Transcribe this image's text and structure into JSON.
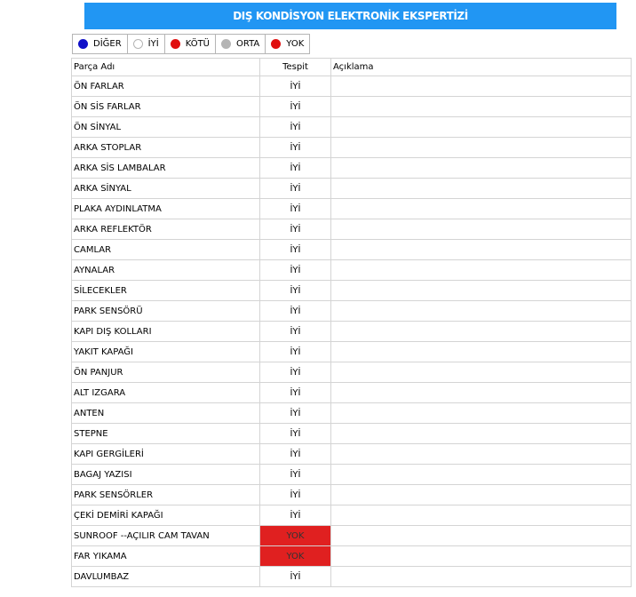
{
  "header": {
    "title": "DIŞ KONDİSYON ELEKTRONİK EKSPERTİZİ"
  },
  "legend": [
    {
      "label": "DİĞER",
      "color": "#1010c8"
    },
    {
      "label": "İYİ",
      "color": "#ffffff"
    },
    {
      "label": "KÖTÜ",
      "color": "#e01010"
    },
    {
      "label": "ORTA",
      "color": "#b4b4b4"
    },
    {
      "label": "YOK",
      "color": "#e01010"
    }
  ],
  "table": {
    "headers": {
      "part": "Parça Adı",
      "status": "Tespit",
      "note": "Açıklama"
    },
    "rows": [
      {
        "part": "ÖN FARLAR",
        "status": "İYİ",
        "note": ""
      },
      {
        "part": "ÖN SİS FARLAR",
        "status": "İYİ",
        "note": ""
      },
      {
        "part": "ÖN SİNYAL",
        "status": "İYİ",
        "note": ""
      },
      {
        "part": "ARKA STOPLAR",
        "status": "İYİ",
        "note": ""
      },
      {
        "part": "ARKA SİS LAMBALAR",
        "status": "İYİ",
        "note": ""
      },
      {
        "part": "ARKA SİNYAL",
        "status": "İYİ",
        "note": ""
      },
      {
        "part": "PLAKA AYDINLATMA",
        "status": "İYİ",
        "note": ""
      },
      {
        "part": "ARKA REFLEKTÖR",
        "status": "İYİ",
        "note": ""
      },
      {
        "part": "CAMLAR",
        "status": "İYİ",
        "note": ""
      },
      {
        "part": "AYNALAR",
        "status": "İYİ",
        "note": ""
      },
      {
        "part": "SİLECEKLER",
        "status": "İYİ",
        "note": ""
      },
      {
        "part": "PARK SENSÖRÜ",
        "status": "İYİ",
        "note": ""
      },
      {
        "part": "KAPI DIŞ KOLLARI",
        "status": "İYİ",
        "note": ""
      },
      {
        "part": "YAKIT KAPAĞI",
        "status": "İYİ",
        "note": ""
      },
      {
        "part": "ÖN PANJUR",
        "status": "İYİ",
        "note": ""
      },
      {
        "part": "ALT IZGARA",
        "status": "İYİ",
        "note": ""
      },
      {
        "part": "ANTEN",
        "status": "İYİ",
        "note": ""
      },
      {
        "part": "STEPNE",
        "status": "İYİ",
        "note": ""
      },
      {
        "part": "KAPI GERGİLERİ",
        "status": "İYİ",
        "note": ""
      },
      {
        "part": "BAGAJ YAZISI",
        "status": "İYİ",
        "note": ""
      },
      {
        "part": "PARK SENSÖRLER",
        "status": "İYİ",
        "note": ""
      },
      {
        "part": "ÇEKİ DEMİRİ KAPAĞI",
        "status": "İYİ",
        "note": ""
      },
      {
        "part": "SUNROOF --AÇILIR CAM TAVAN",
        "status": "YOK",
        "note": ""
      },
      {
        "part": "FAR YIKAMA",
        "status": "YOK",
        "note": ""
      },
      {
        "part": "DAVLUMBAZ",
        "status": "İYİ",
        "note": ""
      }
    ]
  }
}
